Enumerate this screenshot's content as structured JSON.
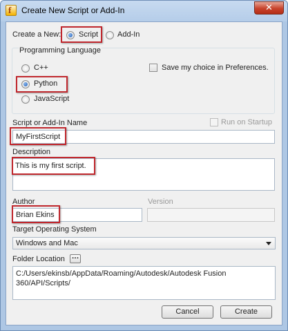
{
  "window": {
    "title": "Create New Script or Add-In",
    "close_glyph": "✕"
  },
  "create_new": {
    "label": "Create a New:",
    "options": [
      {
        "label": "Script",
        "selected": true
      },
      {
        "label": "Add-In",
        "selected": false
      }
    ]
  },
  "language": {
    "group_label": "Programming Language",
    "options": [
      {
        "label": "C++",
        "selected": false
      },
      {
        "label": "Python",
        "selected": true
      },
      {
        "label": "JavaScript",
        "selected": false
      }
    ],
    "save_choice_label": "Save my choice in Preferences.",
    "save_choice_checked": false
  },
  "name": {
    "label": "Script or Add-In Name",
    "value": "MyFirstScript"
  },
  "run_on_startup": {
    "label": "Run on Startup",
    "checked": false,
    "enabled": false
  },
  "description": {
    "label": "Description",
    "value": "This is my first script."
  },
  "author": {
    "label": "Author",
    "value": "Brian Ekins"
  },
  "version": {
    "label": "Version",
    "value": "",
    "enabled": false
  },
  "target_os": {
    "label": "Target Operating System",
    "value": "Windows and Mac"
  },
  "folder": {
    "label": "Folder Location",
    "browse_glyph": "...",
    "value_line1": "C:/Users/ekinsb/AppData/Roaming/Autodesk/Autodesk Fusion",
    "value_line2": "360/API/Scripts/"
  },
  "buttons": {
    "cancel": "Cancel",
    "create": "Create"
  },
  "colors": {
    "highlight_border": "#c0272d",
    "title_bar": "#b5cde9",
    "dialog_bg": "#f0f0f0"
  },
  "icons": {
    "app": "fusion-app-icon",
    "close": "close-icon",
    "browse": "ellipsis-icon",
    "dropdown": "chevron-down-icon"
  }
}
